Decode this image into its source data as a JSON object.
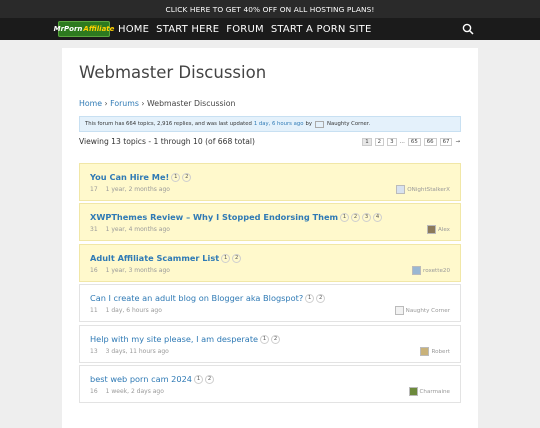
{
  "promo": {
    "text": "CLICK HERE TO GET 40% OFF ON ALL HOSTING PLANS!"
  },
  "header": {
    "logo_main": "MrPorn",
    "logo_sub": "Affiliate",
    "nav": [
      "HOME",
      "START HERE",
      "FORUM",
      "START A PORN SITE"
    ]
  },
  "page": {
    "title": "Webmaster Discussion"
  },
  "breadcrumb": {
    "home": "Home",
    "forums": "Forums",
    "current": "Webmaster Discussion",
    "sep": "›"
  },
  "notice": {
    "prefix": "This forum has 664 topics, 2,916 replies, and was last updated",
    "updated": "1 day, 6 hours ago",
    "by": "by",
    "user": "Naughty Corner."
  },
  "listing": {
    "summary": "Viewing 13 topics - 1 through 10 (of 668 total)",
    "pages": [
      "1",
      "2",
      "3",
      "…",
      "65",
      "66",
      "67",
      "→"
    ]
  },
  "topics": [
    {
      "title": "You Can Hire Me!",
      "pages": [
        "1",
        "2"
      ],
      "replies": "17",
      "freshness": "1 year, 2 months ago",
      "user": "ONightStalkerX",
      "sticky": true,
      "avatar_color": "#d8e2ef"
    },
    {
      "title": "XWPThemes Review – Why I Stopped Endorsing Them",
      "pages": [
        "1",
        "2",
        "3",
        "4"
      ],
      "replies": "31",
      "freshness": "1 year, 4 months ago",
      "user": "Alex",
      "sticky": true,
      "avatar_color": "#8c7a5a"
    },
    {
      "title": "Adult Affiliate Scammer List",
      "pages": [
        "1",
        "2"
      ],
      "replies": "16",
      "freshness": "1 year, 3 months ago",
      "user": "roxette20",
      "sticky": true,
      "avatar_color": "#9ab7d3"
    },
    {
      "title": "Can I create an adult blog on Blogger aka Blogspot?",
      "pages": [
        "1",
        "2"
      ],
      "replies": "11",
      "freshness": "1 day, 6 hours ago",
      "user": "Naughty Corner",
      "sticky": false,
      "avatar_color": "#f2f2f2"
    },
    {
      "title": "Help with my site please, I am desperate",
      "pages": [
        "1",
        "2"
      ],
      "replies": "13",
      "freshness": "3 days, 11 hours ago",
      "user": "Robert",
      "sticky": false,
      "avatar_color": "#c9b27a"
    },
    {
      "title": "best web porn cam 2024",
      "pages": [
        "1",
        "2"
      ],
      "replies": "16",
      "freshness": "1 week, 2 days ago",
      "user": "Charmaine",
      "sticky": false,
      "avatar_color": "#6d8a3c"
    }
  ],
  "icons": {
    "search": "search-icon"
  },
  "colors": {
    "link": "#2f7ab5",
    "sticky_bg": "#fff9cc",
    "notice_bg": "#e4f1fb",
    "nav_bg": "#1b1b1b",
    "logo_bg": "#2d7a1f"
  }
}
